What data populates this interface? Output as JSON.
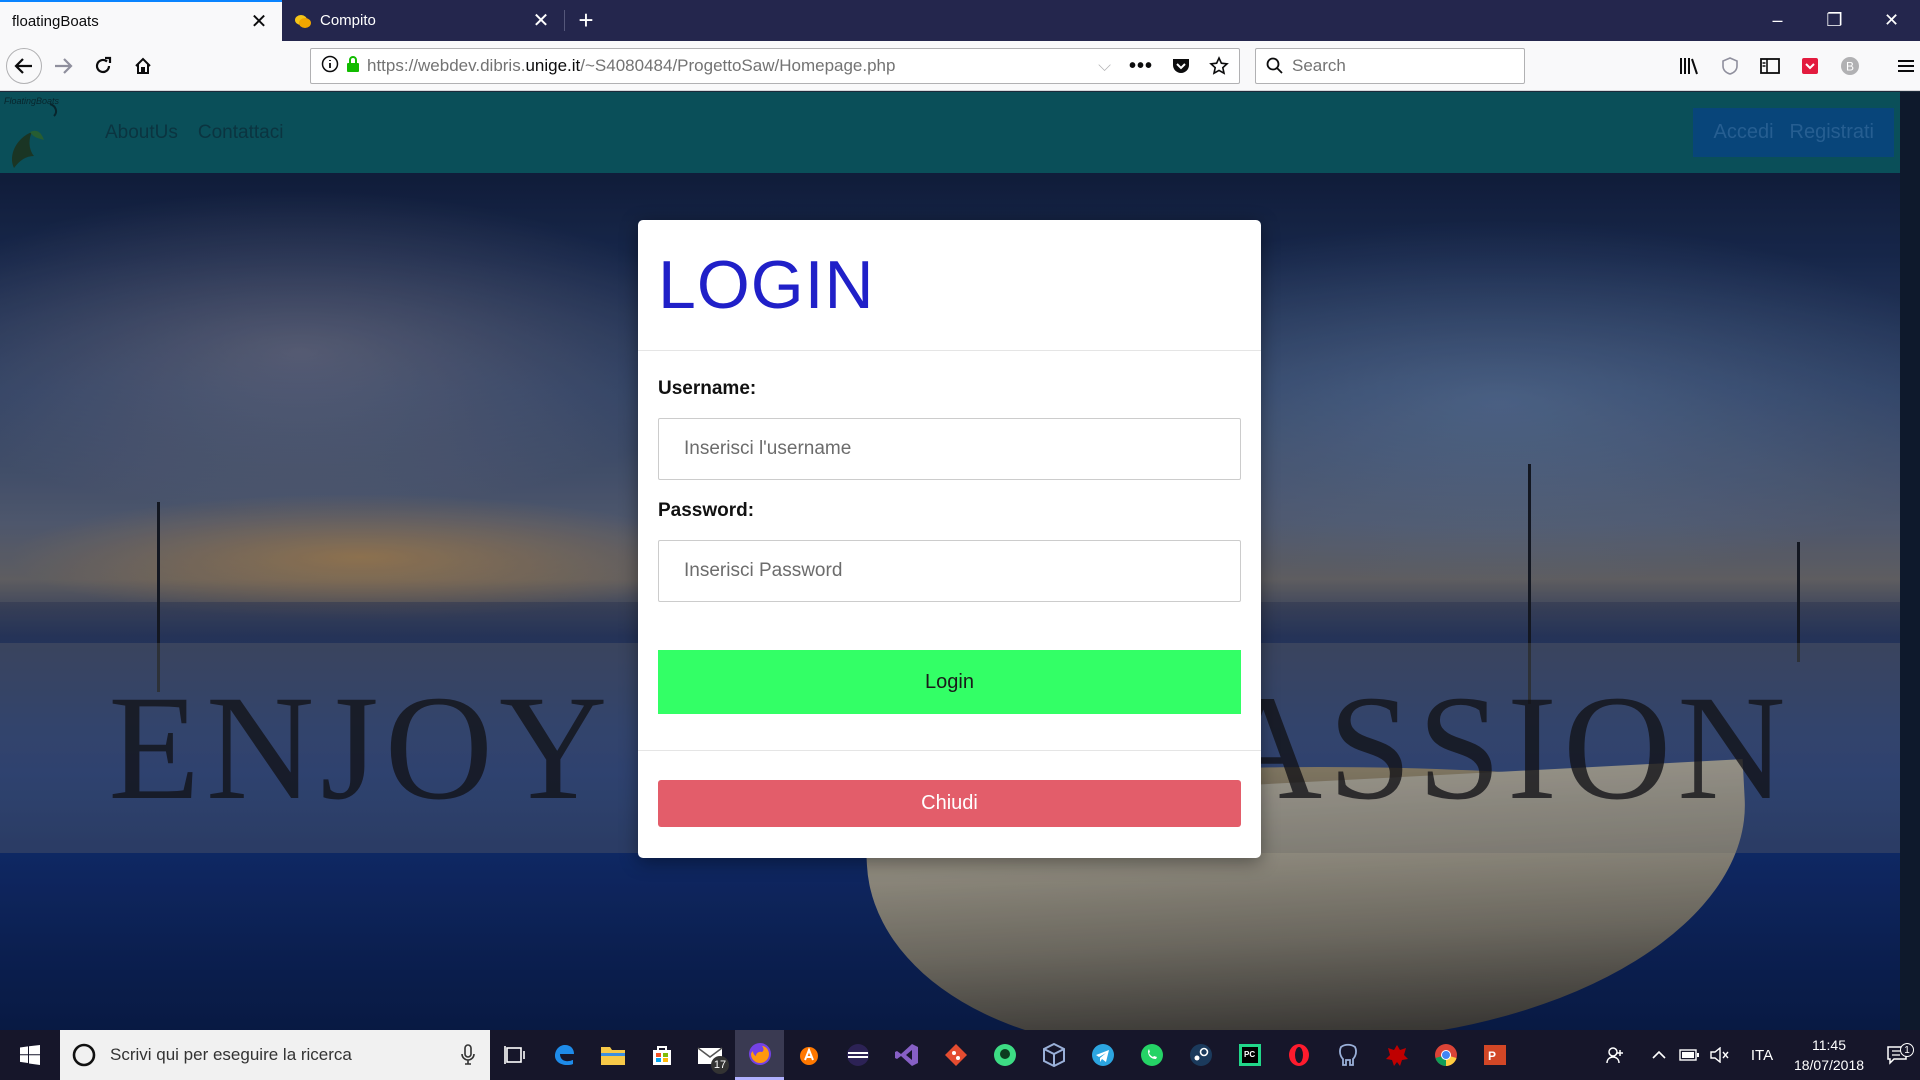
{
  "browser": {
    "tabs": [
      {
        "title": "floatingBoats",
        "active": true
      },
      {
        "title": "Compito",
        "active": false
      }
    ],
    "new_tab_label": "+",
    "url_prefix": "https://webdev.dibris.",
    "url_domain": "unige.it",
    "url_path": "/~S4080484/ProgettoSaw/Homepage.php",
    "search_placeholder": "Search",
    "accent": "#0a84ff"
  },
  "site": {
    "logo_text": "FloatingBoats",
    "nav_links": [
      "AboutUs",
      "Contattaci"
    ],
    "nav_right": [
      "Accedi",
      "Registrati"
    ],
    "banner_text": "ENJOY YOUR PASSION"
  },
  "modal": {
    "title": "LOGIN",
    "username_label": "Username:",
    "username_placeholder": "Inserisci l'username",
    "password_label": "Password:",
    "password_placeholder": "Inserisci Password",
    "login_label": "Login",
    "close_label": "Chiudi",
    "login_color": "#33ff66",
    "close_color": "#e35d6a",
    "title_color": "#2020c8"
  },
  "taskbar": {
    "search_placeholder": "Scrivi qui per eseguire la ricerca",
    "mail_badge": "17",
    "language": "ITA",
    "time": "11:45",
    "date": "18/07/2018",
    "notification_count": "1",
    "apps": [
      "task-view-icon",
      "edge-icon",
      "file-explorer-icon",
      "store-icon",
      "mail-icon",
      "firefox-icon",
      "avast-icon",
      "eclipse-icon",
      "visual-studio-icon",
      "git-icon",
      "android-studio-icon",
      "virtualbox-icon",
      "telegram-icon",
      "whatsapp-icon",
      "steam-icon",
      "pycharm-icon",
      "opera-icon",
      "pgadmin-icon",
      "filezilla-icon",
      "chrome-icon",
      "powerpoint-icon"
    ]
  }
}
